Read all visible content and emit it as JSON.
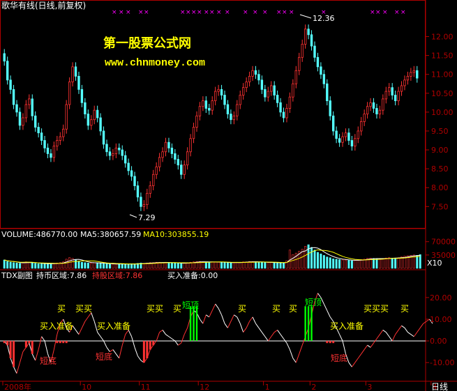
{
  "main": {
    "title": "歌华有线(日线,前复权)",
    "watermark_1": "第一股票公式网",
    "watermark_2": "www.chnmoney.com",
    "high_label": "12.36",
    "low_label": "7.29",
    "y_ticks": [
      "12.00",
      "11.50",
      "11.00",
      "10.50",
      "10.00",
      "9.50",
      "9.00",
      "8.50",
      "8.00",
      "7.50"
    ]
  },
  "volume": {
    "label_vol": "VOLUME:486770.00",
    "label_ma5": "MA5:380657.59",
    "label_ma10": "MA10:303855.19",
    "y_ticks": [
      "70000",
      "35000"
    ],
    "unit": "X10"
  },
  "indicator": {
    "label_name": "TDX副图",
    "label_hold_market": "持币区域:7.86",
    "label_hold_stock": "持股区域:7.86",
    "label_buy_prep": "买入准备:0.00",
    "y_ticks": [
      "20.00",
      "10.00",
      "0.00",
      "-10.00"
    ],
    "signals": {
      "buy": "买",
      "buy2": "买买",
      "buy3": "买买买",
      "prepare": "买入准备",
      "short_top": "短顶",
      "short_bottom": "短底"
    }
  },
  "xaxis": {
    "labels": [
      "2008年",
      "10",
      "11",
      "12",
      "1",
      "2",
      "3",
      "4"
    ],
    "period": "日线"
  },
  "colors": {
    "up": "#ff3232",
    "down": "#54ffff",
    "ma5": "#ffffff",
    "ma10": "#ffff00",
    "axis": "#b00000",
    "signal_top": "#00ff00",
    "marker": "#ff00ff"
  },
  "chart_data": [
    {
      "type": "candlestick",
      "title": "歌华有线(日线,前复权)",
      "ylim": [
        7.1,
        12.6
      ],
      "annotations": [
        {
          "label": "12.36",
          "value": 12.36
        },
        {
          "label": "7.29",
          "value": 7.29
        }
      ],
      "close": [
        11.35,
        10.85,
        10.6,
        10.2,
        10.0,
        9.65,
        9.85,
        10.2,
        10.35,
        9.9,
        9.6,
        9.45,
        9.25,
        9.05,
        8.9,
        8.8,
        9.1,
        9.25,
        9.35,
        9.55,
        10.2,
        10.8,
        11.2,
        10.95,
        10.6,
        10.25,
        9.95,
        9.65,
        9.8,
        10.05,
        9.85,
        9.5,
        9.15,
        8.95,
        8.85,
        8.9,
        9.05,
        9.0,
        8.85,
        8.65,
        8.45,
        8.3,
        8.05,
        7.75,
        7.5,
        7.55,
        7.85,
        8.05,
        8.35,
        8.55,
        8.8,
        8.95,
        9.2,
        9.05,
        8.9,
        8.75,
        8.6,
        8.35,
        8.6,
        8.95,
        9.3,
        9.6,
        9.9,
        10.15,
        10.3,
        10.1,
        10.05,
        10.3,
        10.55,
        10.6,
        10.45,
        10.2,
        9.95,
        9.8,
        9.9,
        10.2,
        10.45,
        10.65,
        10.8,
        10.95,
        11.1,
        11.0,
        10.85,
        10.6,
        10.4,
        10.55,
        10.7,
        10.45,
        10.25,
        10.0,
        9.85,
        10.1,
        10.4,
        10.75,
        11.1,
        11.45,
        11.8,
        12.2,
        12.05,
        11.75,
        11.45,
        11.2,
        11.0,
        10.75,
        10.3,
        9.9,
        9.5,
        9.3,
        9.2,
        9.35,
        9.45,
        9.25,
        9.1,
        9.3,
        9.5,
        9.75,
        9.95,
        10.15,
        10.25,
        10.1,
        9.95,
        10.05,
        10.35,
        10.55,
        10.65,
        10.45,
        10.3,
        10.55,
        10.7,
        10.85,
        10.95,
        11.05,
        11.1,
        10.9
      ]
    },
    {
      "type": "bar",
      "title": "VOLUME",
      "ylim": [
        0,
        75000
      ],
      "values": [
        22000,
        18000,
        16000,
        15000,
        14000,
        13000,
        15000,
        17000,
        16000,
        14000,
        13000,
        12000,
        12000,
        13000,
        12000,
        11000,
        13000,
        14000,
        15000,
        17000,
        24000,
        28000,
        26000,
        22000,
        18000,
        16000,
        15000,
        14000,
        14000,
        15000,
        14000,
        13000,
        12000,
        12000,
        11000,
        11000,
        12000,
        12000,
        11000,
        11000,
        11000,
        12000,
        12000,
        13000,
        14000,
        13000,
        14000,
        15000,
        15000,
        16000,
        16000,
        15000,
        16000,
        15000,
        14000,
        14000,
        13000,
        13000,
        14000,
        15000,
        16000,
        17000,
        18000,
        18000,
        17000,
        16000,
        16000,
        17000,
        17000,
        16000,
        16000,
        15000,
        15000,
        14000,
        15000,
        16000,
        16000,
        17000,
        17000,
        18000,
        18000,
        17000,
        16000,
        16000,
        15000,
        15000,
        16000,
        15000,
        14000,
        14000,
        14000,
        20000,
        48000,
        36000,
        40000,
        45000,
        50000,
        58000,
        62000,
        55000,
        48000,
        42000,
        38000,
        34000,
        30000,
        28000,
        25000,
        24000,
        23000,
        22000,
        22000,
        21000,
        20000,
        21000,
        22000,
        23000,
        24000,
        26000,
        27000,
        26000,
        25000,
        24000,
        26000,
        27000,
        28000,
        27000,
        26000,
        28000,
        30000,
        32000,
        33000,
        34000,
        35000,
        34000,
        36000
      ],
      "series": [
        {
          "name": "MA5",
          "value": 380657.59
        },
        {
          "name": "MA10",
          "value": 303855.19
        }
      ]
    },
    {
      "type": "line",
      "title": "TDX副图",
      "ylim": [
        -17,
        28
      ],
      "series": [
        {
          "name": "持币区域",
          "last": 7.86
        },
        {
          "name": "持股区域",
          "last": 7.86
        },
        {
          "name": "买入准备",
          "last": 0.0
        }
      ],
      "values": [
        0,
        -2,
        -8,
        -12,
        -15,
        -10,
        -5,
        -3,
        -1,
        -6,
        -9,
        -4,
        2,
        0,
        -6,
        -10,
        -4,
        3,
        8,
        10,
        6,
        4,
        7,
        5,
        3,
        6,
        9,
        11,
        13,
        9,
        4,
        2,
        0,
        -3,
        -5,
        -4,
        -6,
        -8,
        -2,
        3,
        5,
        2,
        -3,
        -7,
        -9,
        -10,
        -8,
        -4,
        -2,
        0,
        4,
        5,
        3,
        2,
        1,
        0,
        -2,
        -1,
        3,
        6,
        11,
        14,
        13,
        10,
        8,
        12,
        11,
        14,
        17,
        15,
        12,
        8,
        6,
        9,
        12,
        11,
        8,
        4,
        6,
        9,
        11,
        8,
        6,
        4,
        2,
        0,
        2,
        4,
        5,
        3,
        1,
        -1,
        -4,
        -8,
        -10,
        -6,
        -2,
        2,
        6,
        12,
        18,
        22,
        20,
        17,
        14,
        11,
        9,
        6,
        3,
        0,
        -6,
        -10,
        -12,
        -10,
        -8,
        -6,
        -4,
        -2,
        -3,
        -1,
        1,
        3,
        5,
        4,
        2,
        0,
        3,
        5,
        7,
        6,
        4,
        3,
        2,
        4,
        6,
        8,
        9,
        10,
        8
      ]
    }
  ]
}
